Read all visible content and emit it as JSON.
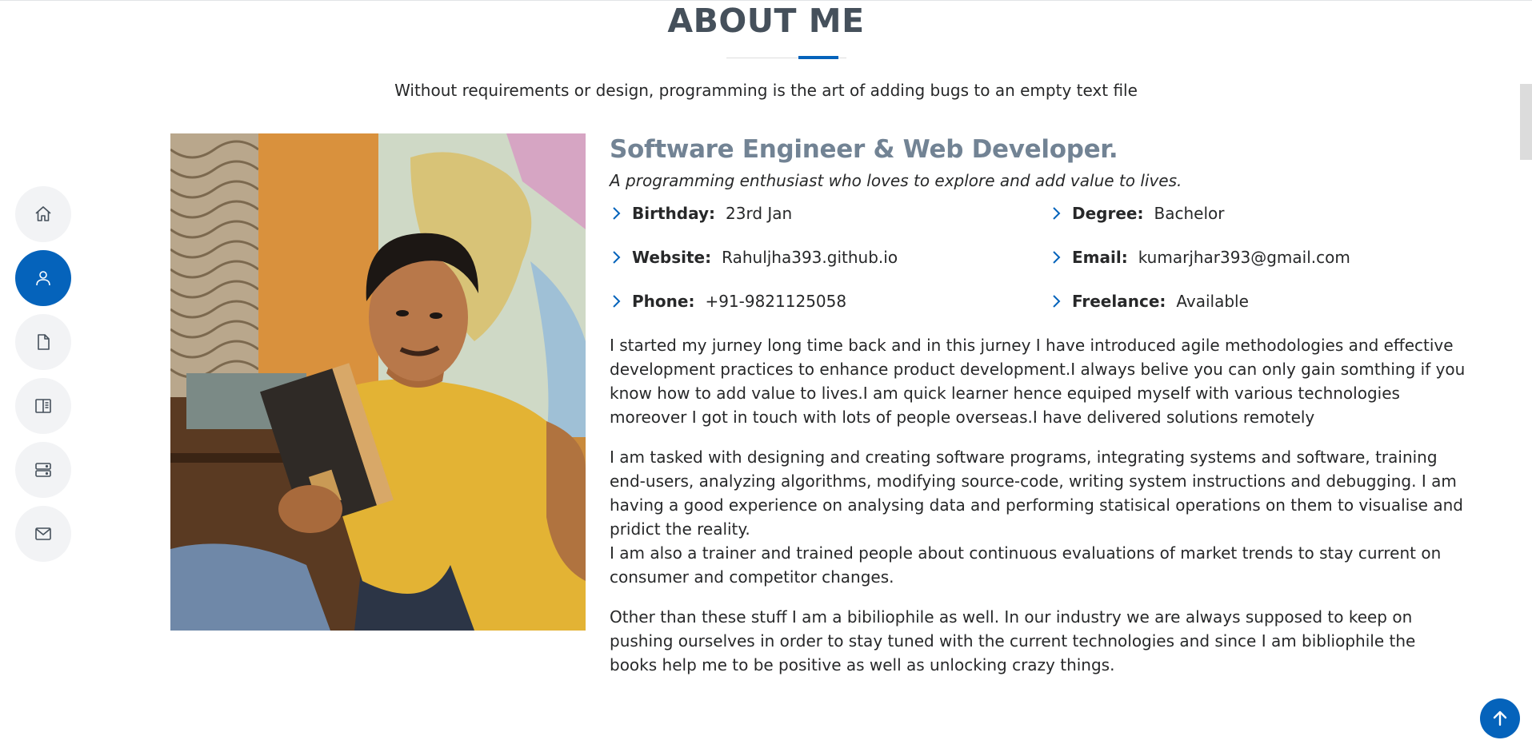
{
  "section": {
    "title": "ABOUT ME",
    "tagline": "Without requirements or design, programming is the art of adding bugs to an empty text file"
  },
  "nav": {
    "items": [
      {
        "name": "home",
        "icon": "home-icon"
      },
      {
        "name": "about",
        "icon": "person-icon",
        "active": true
      },
      {
        "name": "resume",
        "icon": "file-icon"
      },
      {
        "name": "portfolio",
        "icon": "book-icon"
      },
      {
        "name": "services",
        "icon": "server-icon"
      },
      {
        "name": "contact",
        "icon": "envelope-icon"
      }
    ]
  },
  "about": {
    "heading": "Software Engineer & Web Developer.",
    "subtitle": "A programming enthusiast who loves to explore and add value to lives.",
    "facts": {
      "birthday": {
        "label": "Birthday:",
        "value": "23rd Jan"
      },
      "website": {
        "label": "Website:",
        "value": "Rahuljha393.github.io"
      },
      "phone": {
        "label": "Phone:",
        "value": "+91-9821125058"
      },
      "degree": {
        "label": "Degree:",
        "value": "Bachelor"
      },
      "email": {
        "label": "Email:",
        "value": "kumarjhar393@gmail.com"
      },
      "freelance": {
        "label": "Freelance:",
        "value": "Available"
      }
    },
    "paragraphs": [
      "I started my jurney long time back and in this jurney I have introduced agile methodologies and effective development practices to enhance product development.I always belive you can only gain somthing if you know how to add value to lives.I am quick learner hence equiped myself with various technologies moreover I got in touch with lots of people overseas.I have delivered solutions remotely",
      "I am tasked with designing and creating software programs, integrating systems and software, training end-users, analyzing algorithms, modifying source-code, writing system instructions and debugging. I am having a good experience on analysing data and performing statisical operations on them to visualise and pridict the reality.",
      "I am also a trainer and trained people about continuous evaluations of market trends to stay current on consumer and competitor changes.",
      "Other than these stuff I am a bibiliophile as well. In our industry we are always supposed to keep on pushing ourselves in order to stay tuned with the current technologies and since I am bibliophile the books help me to be positive as well as unlocking crazy things."
    ]
  },
  "colors": {
    "accent": "#0563bb",
    "heading": "#45505b",
    "subheading": "#728394"
  },
  "back_to_top": {
    "icon": "arrow-up-icon"
  }
}
